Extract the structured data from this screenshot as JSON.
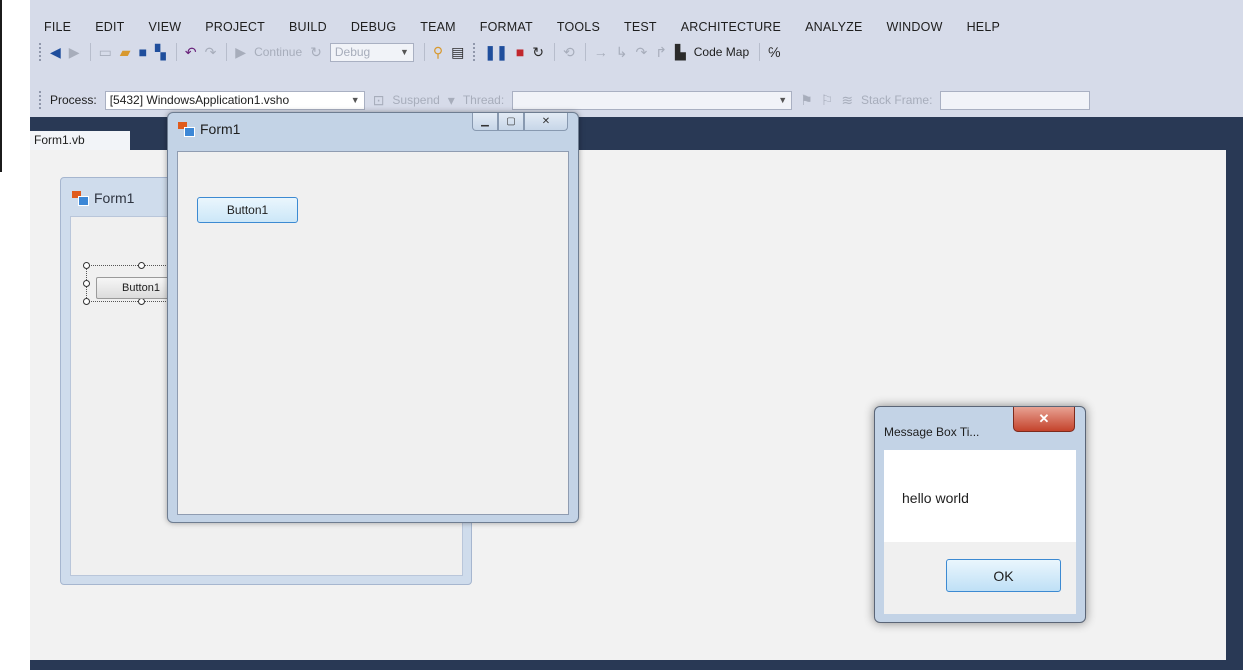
{
  "menu": [
    "FILE",
    "EDIT",
    "VIEW",
    "PROJECT",
    "BUILD",
    "DEBUG",
    "TEAM",
    "FORMAT",
    "TOOLS",
    "TEST",
    "ARCHITECTURE",
    "ANALYZE",
    "WINDOW",
    "HELP"
  ],
  "toolbar1": {
    "continue_label": "Continue",
    "config_value": "Debug",
    "code_map_label": "Code Map"
  },
  "toolbar2": {
    "process_label": "Process:",
    "process_value": "[5432] WindowsApplication1.vsho",
    "suspend_label": "Suspend",
    "thread_label": "Thread:",
    "stack_frame_label": "Stack Frame:"
  },
  "doc_tab": "Form1.vb",
  "designer_form": {
    "title": "Form1",
    "button_label": "Button1"
  },
  "running_form": {
    "title": "Form1",
    "button_label": "Button1"
  },
  "message_box": {
    "title": "Message Box Ti...",
    "message": "hello world",
    "ok_label": "OK"
  }
}
